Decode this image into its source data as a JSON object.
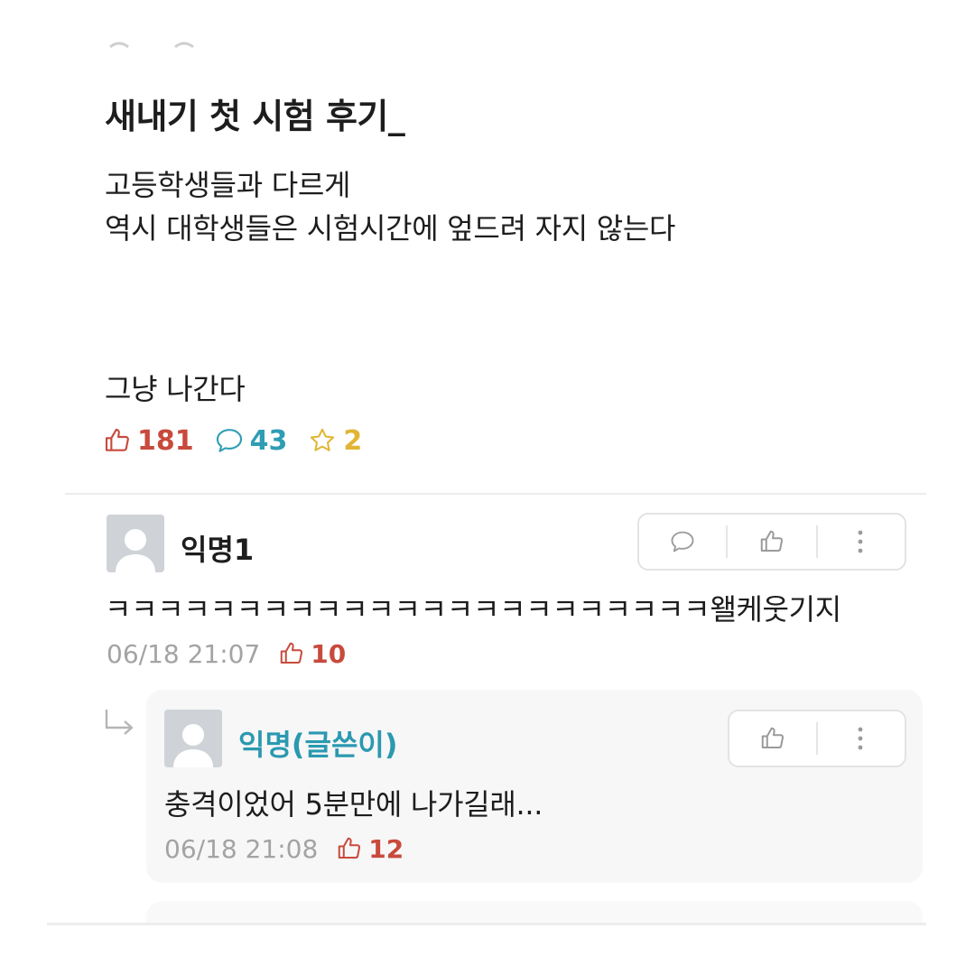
{
  "post": {
    "title": "새내기 첫 시험 후기_",
    "body_lines": [
      "고등학생들과 다르게",
      "역시 대학생들은 시험시간에 엎드려 자지 않는다",
      "그냥 나간다"
    ],
    "stats": {
      "likes": "181",
      "comments": "43",
      "scraps": "2"
    }
  },
  "comments": [
    {
      "author": "익명1",
      "text": "ㅋㅋㅋㅋㅋㅋㅋㅋㅋㅋㅋㅋㅋㅋㅋㅋㅋㅋㅋㅋㅋㅋㅋ왤케웃기지",
      "time": "06/18 21:07",
      "likes": "10"
    }
  ],
  "replies": [
    {
      "author": "익명(글쓴이)",
      "text": "충격이었어 5분만에 나가길래...",
      "time": "06/18 21:08",
      "likes": "12"
    }
  ],
  "icons": {
    "like": "thumbs-up-icon",
    "comment": "speech-bubble-icon",
    "scrap": "star-icon",
    "more": "more-vertical-icon",
    "reply": "reply-arrow-icon"
  },
  "colors": {
    "like": "#c84a3c",
    "comment": "#2f9db4",
    "scrap": "#e1b533",
    "author_highlight": "#2b99b0",
    "meta_gray": "#a3a3a3"
  }
}
